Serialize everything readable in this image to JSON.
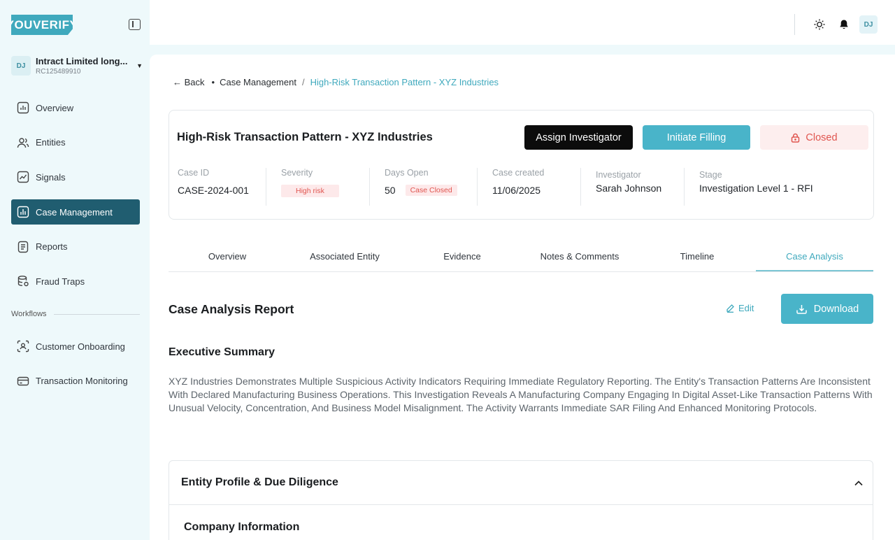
{
  "logo": {
    "text": "YOUVERIFY"
  },
  "org": {
    "initials": "DJ",
    "name": "Intract Limited long...",
    "id": "RC125489910"
  },
  "sidebar": {
    "items": [
      {
        "label": "Overview"
      },
      {
        "label": "Entities"
      },
      {
        "label": "Signals"
      },
      {
        "label": "Case Management"
      },
      {
        "label": "Reports"
      },
      {
        "label": "Fraud Traps"
      }
    ],
    "section_label": "Workflows",
    "workflows": [
      {
        "label": "Customer Onboarding"
      },
      {
        "label": "Transaction Monitoring"
      }
    ]
  },
  "topbar": {
    "user_initials": "DJ"
  },
  "breadcrumb": {
    "back": "Back",
    "parent": "Case Management",
    "separator": "/",
    "current": "High-Risk Transaction Pattern - XYZ Industries"
  },
  "case": {
    "title": "High-Risk Transaction Pattern - XYZ Industries",
    "actions": {
      "assign": "Assign Investigator",
      "initiate": "Initiate Filling",
      "closed": "Closed"
    },
    "meta": {
      "case_id": {
        "label": "Case ID",
        "value": "CASE-2024-001"
      },
      "severity": {
        "label": "Severity",
        "value": "High risk"
      },
      "days_open": {
        "label": "Days Open",
        "value": "50",
        "badge": "Case Closed"
      },
      "created": {
        "label": "Case created",
        "value": "11/06/2025"
      },
      "investigator": {
        "label": "Investigator",
        "value": "Sarah Johnson"
      },
      "stage": {
        "label": "Stage",
        "value": "Investigation Level 1 - RFI"
      }
    }
  },
  "tabs": [
    {
      "label": "Overview"
    },
    {
      "label": "Associated Entity"
    },
    {
      "label": "Evidence"
    },
    {
      "label": "Notes & Comments"
    },
    {
      "label": "Timeline"
    },
    {
      "label": "Case Analysis"
    }
  ],
  "report": {
    "title": "Case Analysis Report",
    "edit_label": "Edit",
    "download_label": "Download",
    "exec_title": "Executive Summary",
    "exec_text": "XYZ Industries Demonstrates Multiple Suspicious Activity Indicators Requiring Immediate Regulatory Reporting. The Entity's Transaction Patterns Are Inconsistent With Declared Manufacturing Business Operations. This Investigation Reveals A Manufacturing Company Engaging In Digital Asset-Like Transaction Patterns With Unusual Velocity, Concentration, And Business Model Misalignment. The Activity Warrants Immediate SAR Filing And Enhanced Monitoring Protocols."
  },
  "accordion": {
    "title": "Entity Profile & Due Diligence",
    "subsection": "Company Information"
  },
  "colors": {
    "accent": "#49b4c9",
    "nav_active": "#205d70",
    "risk": "#e0554f"
  }
}
